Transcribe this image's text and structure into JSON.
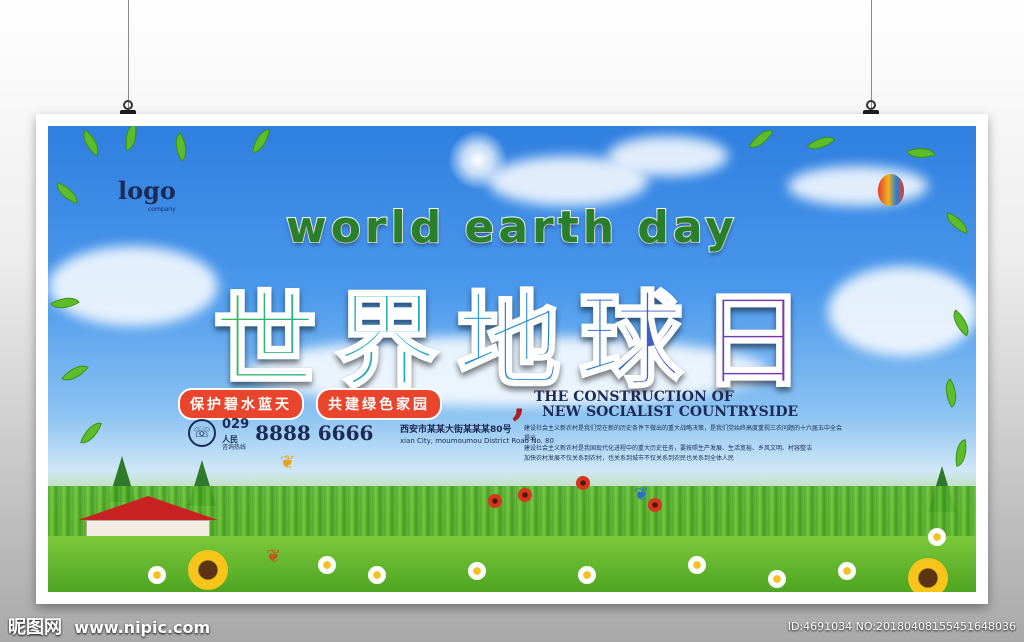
{
  "poster": {
    "logo": "logo",
    "logo_sub": "company",
    "title_en": "world earth day",
    "title_cn": "世界地球日",
    "slogans": [
      "保护碧水蓝天",
      "共建绿色家园"
    ],
    "comma": ",",
    "heading_en_line1": "THE CONSTRUCTION OF",
    "heading_en_line2": "NEW SOCIALIST COUNTRYSIDE",
    "phone_area_prefix": "029",
    "phone_area_suffix": "人民",
    "phone_number": "8888 6666",
    "phone_sub": "咨询热线",
    "address_cn": "西安市某某大街某某某80号",
    "address_en": "xian City, moumoumou District Road No. 80",
    "body_lines": [
      "建设社会主义新农村是我们党在新的历史条件下做出的重大战略决策，是我们党始终高度重视三农问题的十六届五中全会提出",
      "建设社会主义新农村是我国现代化进程中的重大历史任务，要按照生产发展、生活宽裕、乡风文明、村容整洁",
      "加快农村发展不仅关系到农村，也关系到城市不仅关系到农民也关系到全体人民"
    ]
  },
  "watermark": {
    "brand": "昵图网",
    "url": "www.nipic.com",
    "meta": "ID:4691034 NO:20180408155451648036"
  },
  "colors": {
    "accent_red": "#e8452c",
    "navy": "#1c2a55",
    "sky": "#2f7fe0",
    "grass": "#4ea522"
  }
}
